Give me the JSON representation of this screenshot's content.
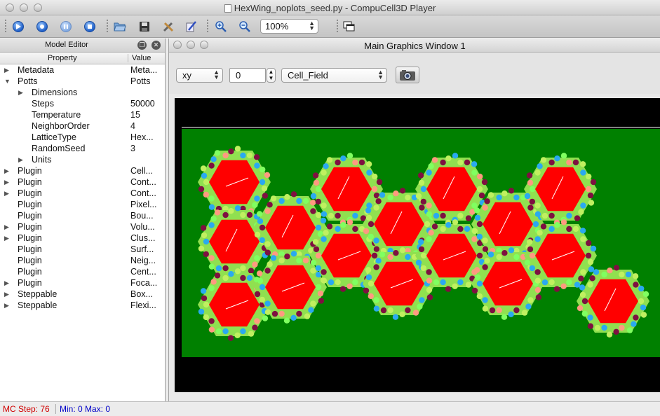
{
  "window": {
    "title": "HexWing_noplots_seed.py - CompuCell3D Player"
  },
  "toolbar": {
    "zoom_value": "100%",
    "icons": [
      "play-icon",
      "step-icon",
      "pause-icon",
      "stop-icon",
      "open-file-icon",
      "save-icon",
      "tools-icon",
      "edit-icon",
      "zoom-in-icon",
      "zoom-out-icon",
      "new-window-icon"
    ]
  },
  "model_editor": {
    "title": "Model Editor",
    "col_property": "Property",
    "col_value": "Value",
    "rows": [
      {
        "property": "Metadata",
        "value": "Meta...",
        "arrow": "▶"
      },
      {
        "property": "Potts",
        "value": "Potts",
        "arrow": "▼"
      },
      {
        "property": "Dimensions",
        "value": "",
        "arrow": "▶"
      },
      {
        "property": "Steps",
        "value": "50000",
        "arrow": ""
      },
      {
        "property": "Temperature",
        "value": "15",
        "arrow": ""
      },
      {
        "property": "NeighborOrder",
        "value": "4",
        "arrow": ""
      },
      {
        "property": "LatticeType",
        "value": "Hex...",
        "arrow": ""
      },
      {
        "property": "RandomSeed",
        "value": "3",
        "arrow": ""
      },
      {
        "property": "Units",
        "value": "",
        "arrow": "▶"
      },
      {
        "property": "Plugin",
        "value": "Cell...",
        "arrow": "▶"
      },
      {
        "property": "Plugin",
        "value": "Cont...",
        "arrow": "▶"
      },
      {
        "property": "Plugin",
        "value": "Cont...",
        "arrow": "▶"
      },
      {
        "property": "Plugin",
        "value": "Pixel...",
        "arrow": ""
      },
      {
        "property": "Plugin",
        "value": "Bou...",
        "arrow": ""
      },
      {
        "property": "Plugin",
        "value": "Volu...",
        "arrow": "▶"
      },
      {
        "property": "Plugin",
        "value": "Clus...",
        "arrow": "▶"
      },
      {
        "property": "Plugin",
        "value": "Surf...",
        "arrow": ""
      },
      {
        "property": "Plugin",
        "value": "Neig...",
        "arrow": ""
      },
      {
        "property": "Plugin",
        "value": "Cent...",
        "arrow": ""
      },
      {
        "property": "Plugin",
        "value": "Foca...",
        "arrow": "▶"
      },
      {
        "property": "Steppable",
        "value": "Box...",
        "arrow": "▶"
      },
      {
        "property": "Steppable",
        "value": "Flexi...",
        "arrow": "▶"
      }
    ]
  },
  "graphics": {
    "title": "Main Graphics Window 1",
    "plane": "xy",
    "position": "0",
    "field": "Cell_Field",
    "colors": {
      "medium": "#008000",
      "cell": "#ff0000",
      "border": "#000000"
    }
  },
  "status": {
    "mc_step_label": "MC Step: 76",
    "minmax_label": "Min: 0 Max: 0"
  }
}
